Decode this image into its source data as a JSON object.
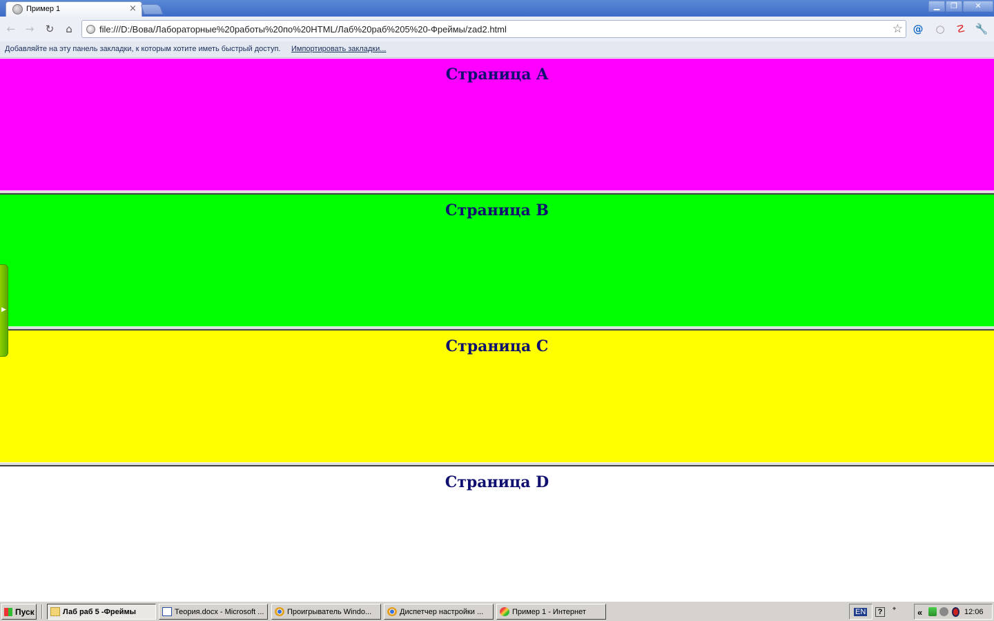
{
  "browser": {
    "tab_title": "Пример 1",
    "tab_close": "×",
    "address": "file:///D:/Вова/Лабораторные%20работы%20по%20HTML/Лаб%20раб%205%20-Фреймы/zad2.html",
    "bookmarks_prompt": "Добавляйте на эту панель закладки, к которым хотите иметь быстрый доступ.",
    "import_bookmarks_link": "Импортировать закладки...",
    "window_buttons": {
      "minimize": "▁",
      "maximize": "❐",
      "close": "✕"
    },
    "nav": {
      "back": "←",
      "forward": "→",
      "reload": "↻",
      "home": "⌂",
      "star": "☆"
    },
    "extensions": {
      "mail": "@",
      "search": "○",
      "antivirus": "☡",
      "settings": "🔧"
    }
  },
  "frames": [
    {
      "heading": "Страница A",
      "color": "#ff00ff"
    },
    {
      "heading": "Страница B",
      "color": "#00ff00"
    },
    {
      "heading": "Страница C",
      "color": "#ffff00"
    },
    {
      "heading": "Страница D",
      "color": "#ffffff"
    }
  ],
  "taskbar": {
    "start_label": "Пуск",
    "tasks": [
      {
        "label": "Лаб раб 5 -Фреймы",
        "icon": "folder-icon"
      },
      {
        "label": "Теория.docx - Microsoft ...",
        "icon": "word-icon"
      },
      {
        "label": "Проигрыватель Windo...",
        "icon": "chrome-icon"
      },
      {
        "label": "Диспетчер настройки ...",
        "icon": "chrome-icon"
      },
      {
        "label": "Пример 1 - Интернет",
        "icon": "ie-icon"
      }
    ],
    "lang": "EN",
    "help": "?",
    "tray_expand": "«",
    "clock": "12:06"
  }
}
